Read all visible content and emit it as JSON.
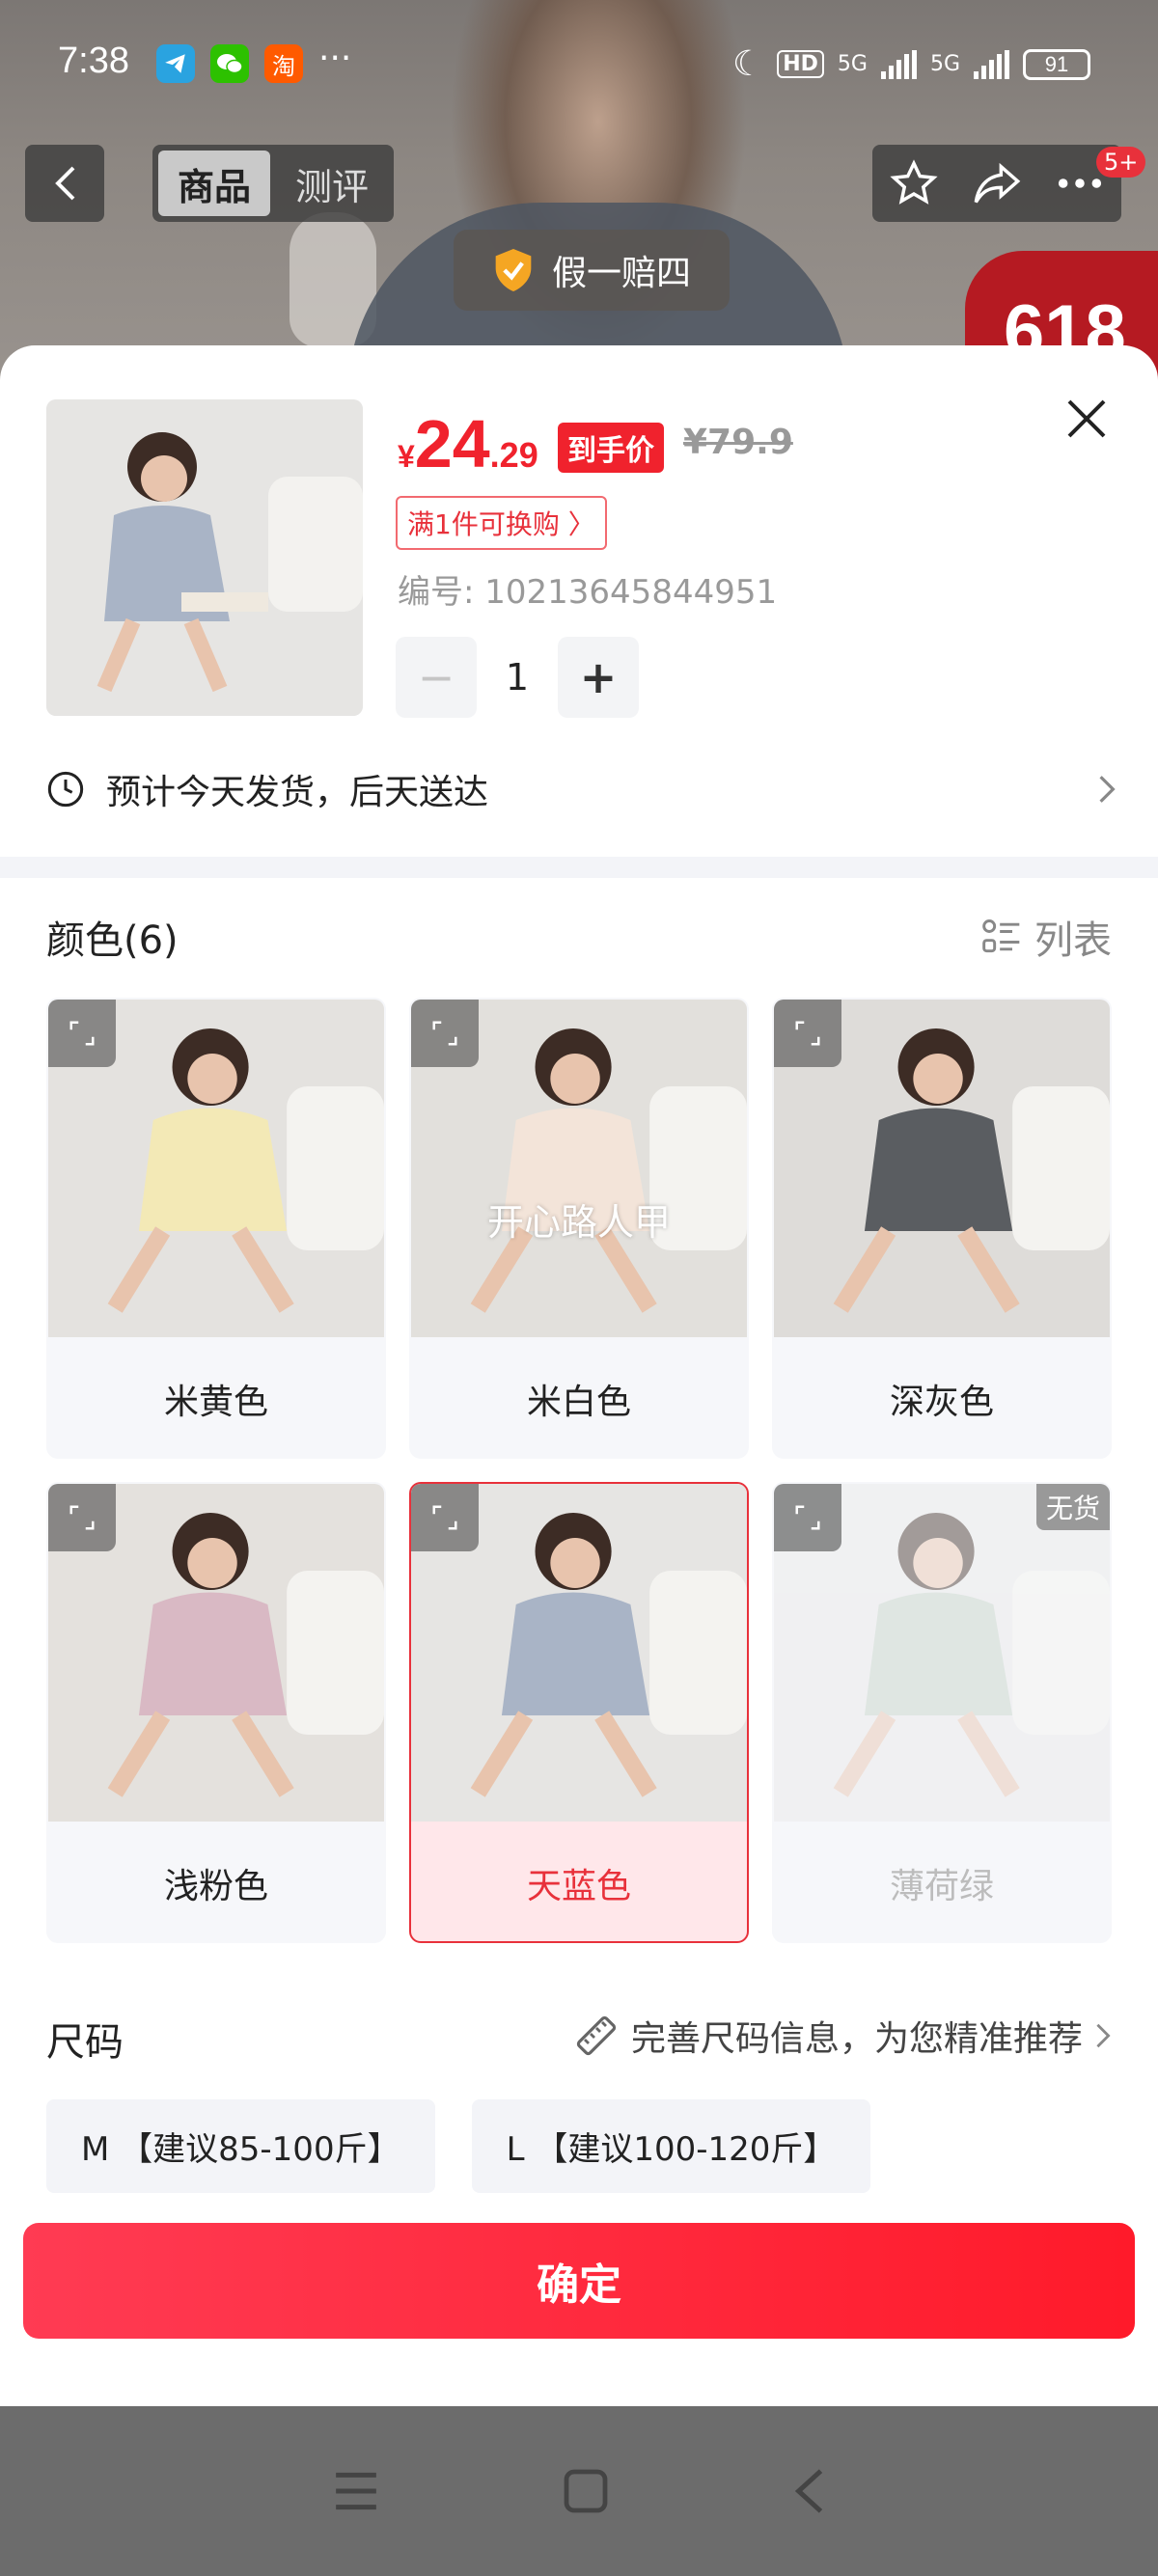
{
  "status_bar": {
    "time": "7:38",
    "more": "···",
    "apps": [
      "telegram-icon",
      "wechat-icon",
      "taobao-icon"
    ],
    "taobao_glyph": "淘",
    "hd_label": "HD",
    "network_1": "5G",
    "network_2": "5G",
    "battery": "91"
  },
  "header": {
    "tabs": [
      {
        "label": "商品",
        "active": true
      },
      {
        "label": "测评",
        "active": false
      }
    ],
    "message_badge": "5+",
    "guarantee": "假一赔四",
    "promo_text": "618"
  },
  "product": {
    "price_currency": "¥",
    "price_integer": "24",
    "price_decimal": ".29",
    "price_tag": "到手价",
    "original_price": "¥79.9",
    "exchange_tag": "满1件可换购 〉",
    "code": "编号: 10213645844951",
    "quantity": "1",
    "minus": "−",
    "plus": "+",
    "delivery": "预计今天发货，后天送达"
  },
  "colors": {
    "title": "颜色(6)",
    "list_label": "列表",
    "items": [
      {
        "label": "米黄色",
        "state": "normal",
        "shirt": "#f3e9b6",
        "bg": "#e4e2df"
      },
      {
        "label": "米白色",
        "state": "normal",
        "shirt": "#f3e4d9",
        "bg": "#e2e0dc",
        "watermark": "开心路人甲"
      },
      {
        "label": "深灰色",
        "state": "normal",
        "shirt": "#5a5d61",
        "bg": "#dedcd9"
      },
      {
        "label": "浅粉色",
        "state": "normal",
        "shirt": "#d9b9c4",
        "bg": "#e4e1dd"
      },
      {
        "label": "天蓝色",
        "state": "selected",
        "shirt": "#a9b4c6",
        "bg": "#e6e5e3"
      },
      {
        "label": "薄荷绿",
        "state": "disabled",
        "shirt": "#c5d3c7",
        "bg": "#e9e9e9",
        "stock_tag": "无货"
      }
    ]
  },
  "size": {
    "title": "尺码",
    "hint": "完善尺码信息，为您精准推荐",
    "options": [
      "M 【建议85-100斤】",
      "L 【建议100-120斤】"
    ]
  },
  "confirm_label": "确定",
  "theme": {
    "accent": "#f0222d",
    "sheet_bg": "#ffffff"
  }
}
